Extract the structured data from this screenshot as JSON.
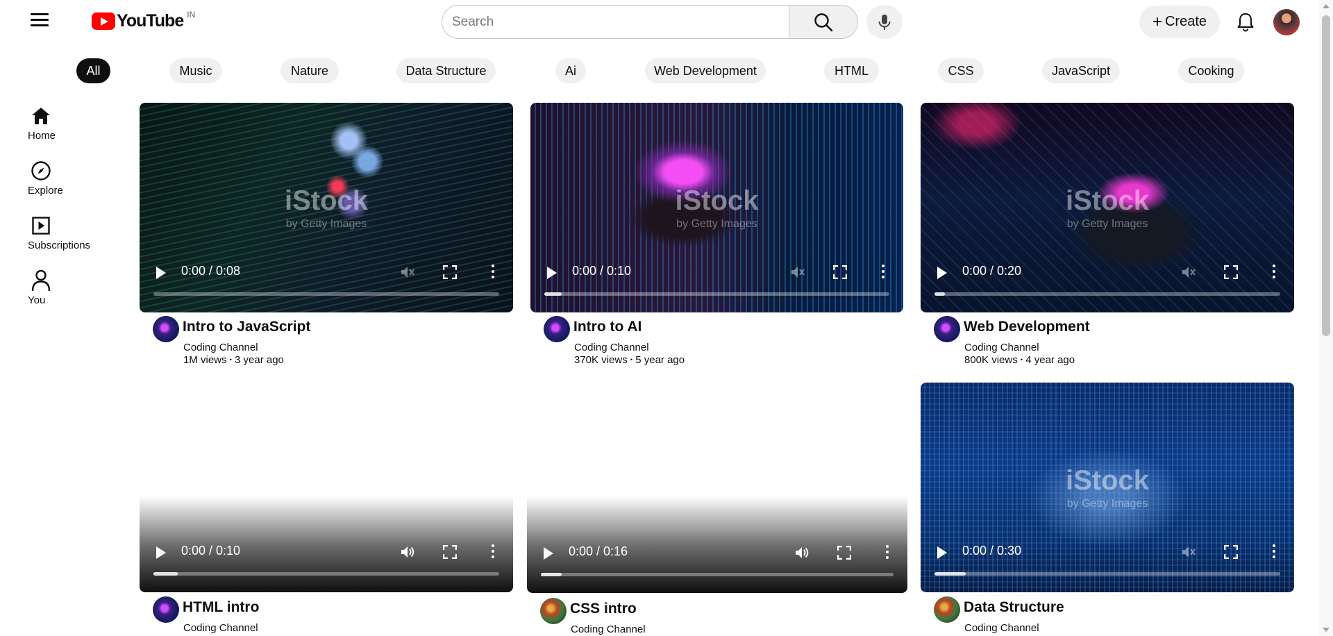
{
  "header": {
    "logo_text": "YouTube",
    "country_code": "IN",
    "search_placeholder": "Search",
    "create_label": "Create"
  },
  "chips": [
    "All",
    "Music",
    "Nature",
    "Data Structure",
    "Ai",
    "Web Development",
    "HTML",
    "CSS",
    "JavaScript",
    "Cooking"
  ],
  "sidebar": {
    "items": [
      {
        "label": "Home",
        "icon": "home-icon"
      },
      {
        "label": "Explore",
        "icon": "compass-icon"
      },
      {
        "label": "Subscriptions",
        "icon": "subscriptions-icon"
      },
      {
        "label": "You",
        "icon": "person-icon"
      }
    ]
  },
  "videos": [
    {
      "title": "Intro to JavaScript",
      "channel": "Coding Channel",
      "views": "1M views",
      "age": "3 year ago",
      "time": "0:00 / 0:08",
      "progress": 0
    },
    {
      "title": "Intro to AI",
      "channel": "Coding Channel",
      "views": "370K views",
      "age": "5 year ago",
      "time": "0:00 / 0:10",
      "progress": 0.05
    },
    {
      "title": "Web Development",
      "channel": "Coding Channel",
      "views": "800K views",
      "age": "4 year ago",
      "time": "0:00 / 0:20",
      "progress": 0.03
    },
    {
      "title": "HTML intro",
      "channel": "Coding Channel",
      "time": "0:00 / 0:10",
      "progress": 0.07
    },
    {
      "title": "CSS intro",
      "channel": "Coding Channel",
      "time": "0:00 / 0:16",
      "progress": 0.06
    },
    {
      "title": "Data Structure",
      "channel": "Coding Channel",
      "time": "0:00 / 0:30",
      "progress": 0.09
    }
  ],
  "watermark": {
    "text": "iStock",
    "sub": "by Getty Images"
  },
  "stats_separator": "•"
}
